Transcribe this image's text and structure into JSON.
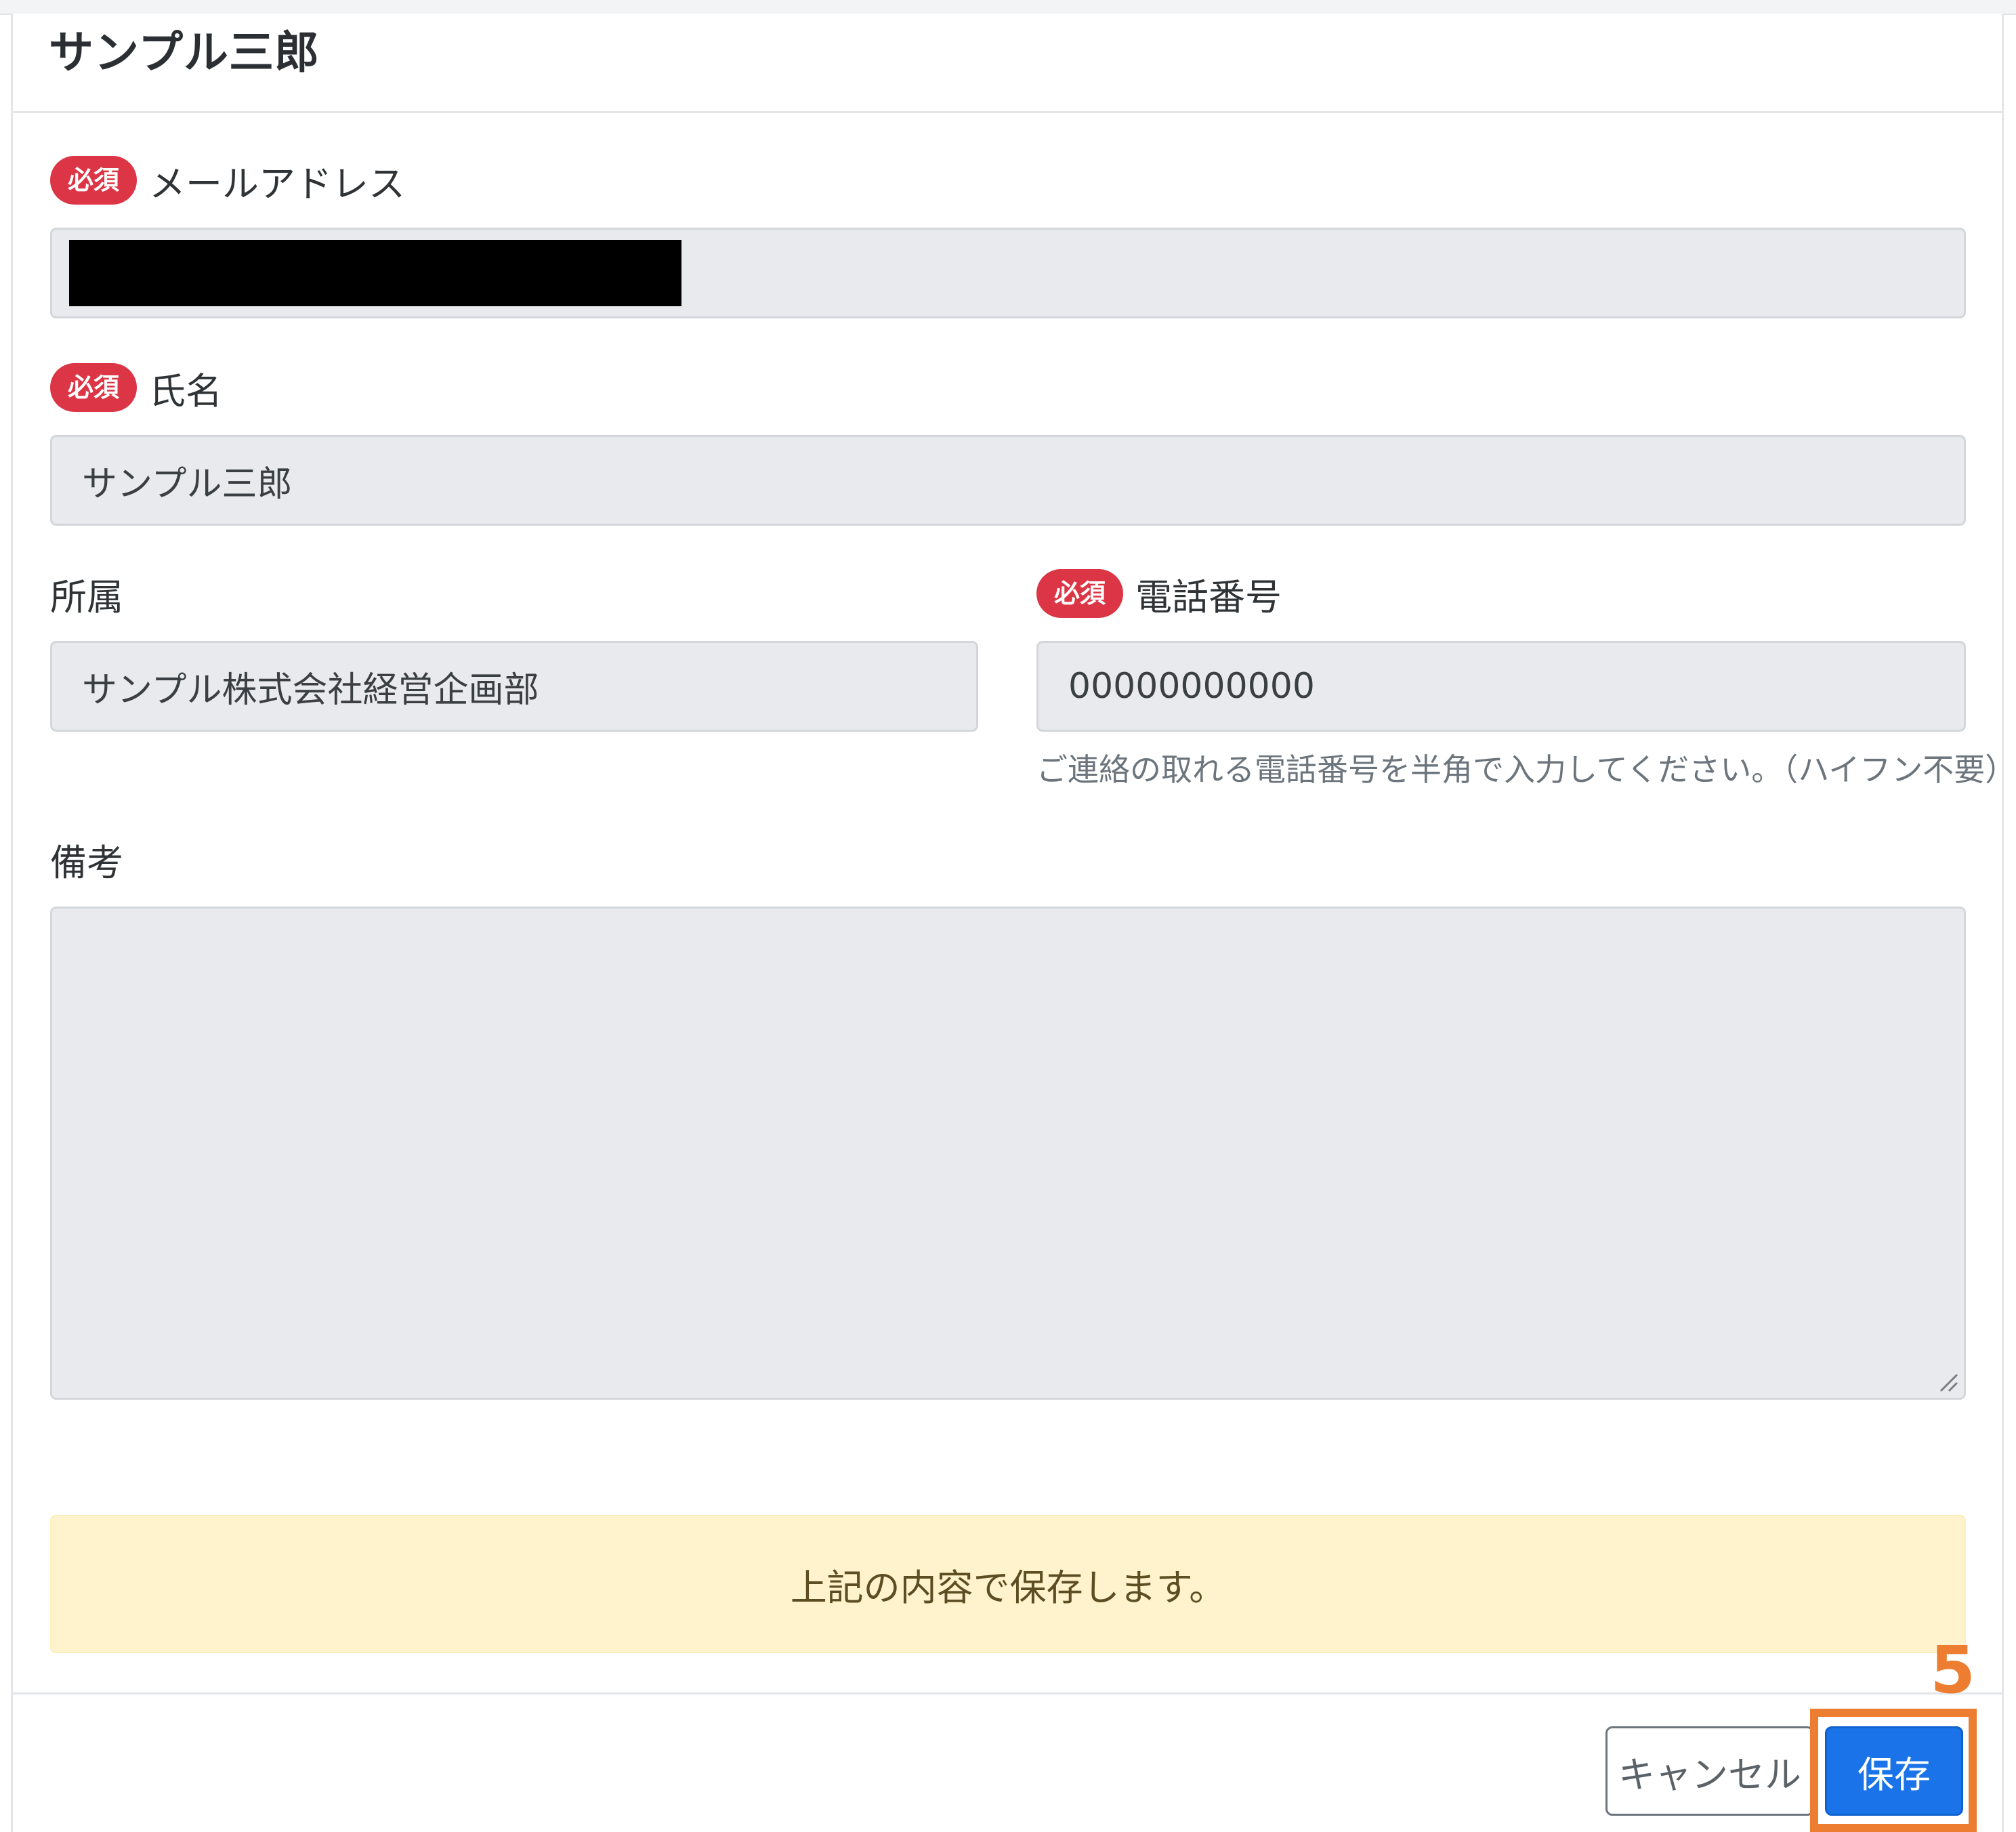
{
  "header": {
    "title": "サンプル三郎"
  },
  "form": {
    "required_badge": "必須",
    "email": {
      "label": "メールアドレス",
      "value": ""
    },
    "name": {
      "label": "氏名",
      "value": "サンプル三郎"
    },
    "affiliation": {
      "label": "所属",
      "value": "サンプル株式会社経営企画部"
    },
    "phone": {
      "label": "電話番号",
      "value": "00000000000",
      "help": "ご連絡の取れる電話番号を半角で入力してください。（ハイフン不要）"
    },
    "remarks": {
      "label": "備考",
      "value": ""
    }
  },
  "alert": {
    "message": "上記の内容で保存します。"
  },
  "footer": {
    "cancel_label": "キャンセル",
    "save_label": "保存"
  },
  "annotation": {
    "step": "5",
    "color": "#ed7d31"
  },
  "colors": {
    "required": "#dc3545",
    "primary": "#1a73e8",
    "alert_bg": "#fff3cd",
    "field_bg": "#e8eaed"
  }
}
